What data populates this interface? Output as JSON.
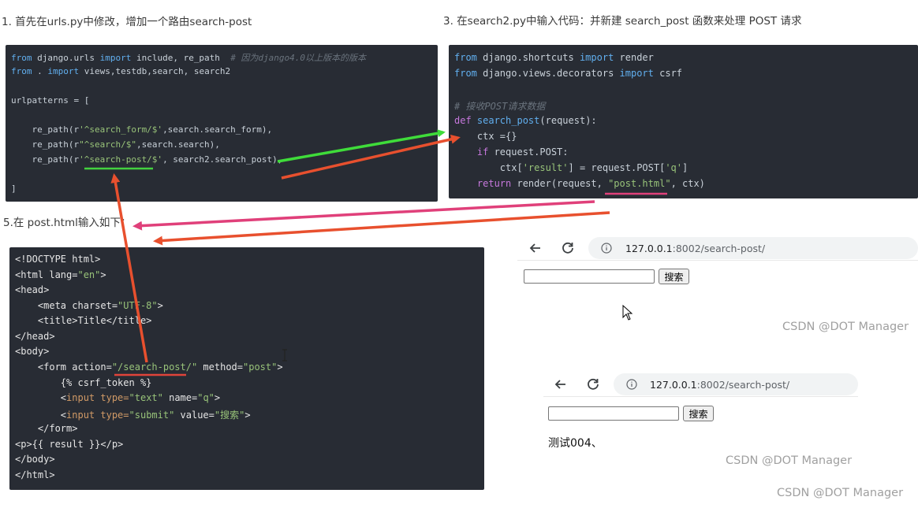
{
  "captions": {
    "step1": "1. 首先在urls.py中修改，增加一个路由search-post",
    "step3": "3.  在search2.py中输入代码：并新建 search_post 函数来处理 POST 请求",
    "step5": "5.在 post.html输入如下："
  },
  "urls_code": {
    "l1_from": "from",
    "l1_mod": " django.urls ",
    "l1_import": "import",
    "l1_rest": " include, re_path  ",
    "l1_comment": "# 因为django4.0以上版本的版本",
    "l2_from": "from",
    "l2_mid": " . ",
    "l2_import": "import",
    "l2_rest": " views,testdb,search, search2",
    "l4": "urlpatterns = [",
    "l6_a": "    re_path(r",
    "l6_s": "'^search_form/$'",
    "l6_b": ",search.search_form),",
    "l7_a": "    re_path(r",
    "l7_s": "\"^search/$\"",
    "l7_b": ",search.search),",
    "l8_a": "    re_path(r",
    "l8_s": "'^search-post/$'",
    "l8_b": ", search2.search_post),",
    "l10": "]"
  },
  "view_code": {
    "l1_from": "from",
    "l1_mod": " django.shortcuts ",
    "l1_import": "import",
    "l1_rest": " render",
    "l2_from": "from",
    "l2_mod": " django.views.decorators ",
    "l2_import": "import",
    "l2_rest": " csrf",
    "l4_comment": "# 接收POST请求数据",
    "l5_def": "def",
    "l5_fn": " search_post",
    "l5_rest": "(request):",
    "l6": "    ctx ={}",
    "l7_if": "    if",
    "l7_rest": " request.POST:",
    "l8_a": "        ctx[",
    "l8_s1": "'result'",
    "l8_b": "] = request.POST[",
    "l8_s2": "'q'",
    "l8_c": "]",
    "l9_ret": "    return",
    "l9_a": " render(request, ",
    "l9_s": "\"post.html\"",
    "l9_b": ", ctx)"
  },
  "html_code": {
    "l1": "<!DOCTYPE html>",
    "l2_a": "<html lang=",
    "l2_s": "\"en\"",
    "l2_b": ">",
    "l3": "<head>",
    "l4_a": "    <meta charset=",
    "l4_s": "\"UTF-8\"",
    "l4_b": ">",
    "l5": "    <title>Title</title>",
    "l6": "</head>",
    "l7": "<body>",
    "l8_a": "    <form action=",
    "l8_s": "\"/search-post/\"",
    "l8_b": " method=",
    "l8_s2": "\"post\"",
    "l8_c": ">",
    "l9": "        {% csrf_token %}",
    "l10_a": "        <",
    "l10_tag": "input",
    "l10_b": " type=",
    "l10_s1": "\"text\"",
    "l10_c": " name=",
    "l10_s2": "\"q\"",
    "l10_d": ">",
    "l11_a": "        <",
    "l11_tag": "input",
    "l11_b": " type=",
    "l11_s1": "\"submit\"",
    "l11_c": " value=",
    "l11_s2": "\"搜索\"",
    "l11_d": ">",
    "l12": "    </form>",
    "l13": "<p>{{ result }}</p>",
    "l14": "</body>",
    "l15": "</html>"
  },
  "browser1": {
    "back_icon": "back-arrow-icon",
    "reload_icon": "reload-icon",
    "info_icon": "info-icon",
    "url_host": "127.0.0.1",
    "url_path": ":8002/search-post/",
    "input_value": "",
    "submit_label": "搜索",
    "watermark": "CSDN @DOT Manager"
  },
  "browser2": {
    "url_host": "127.0.0.1",
    "url_path": ":8002/search-post/",
    "input_value": "",
    "submit_label": "搜索",
    "result_text": "测试004、",
    "watermark": "CSDN @DOT Manager"
  },
  "page_watermark": "CSDN @DOT Manager",
  "colors": {
    "code_bg": "#282c34",
    "arrow_green": "#3fdc3a",
    "arrow_red": "#e8502e",
    "arrow_pink": "#e0407a",
    "underline_green": "#43d13f",
    "underline_red": "#e0443a"
  }
}
